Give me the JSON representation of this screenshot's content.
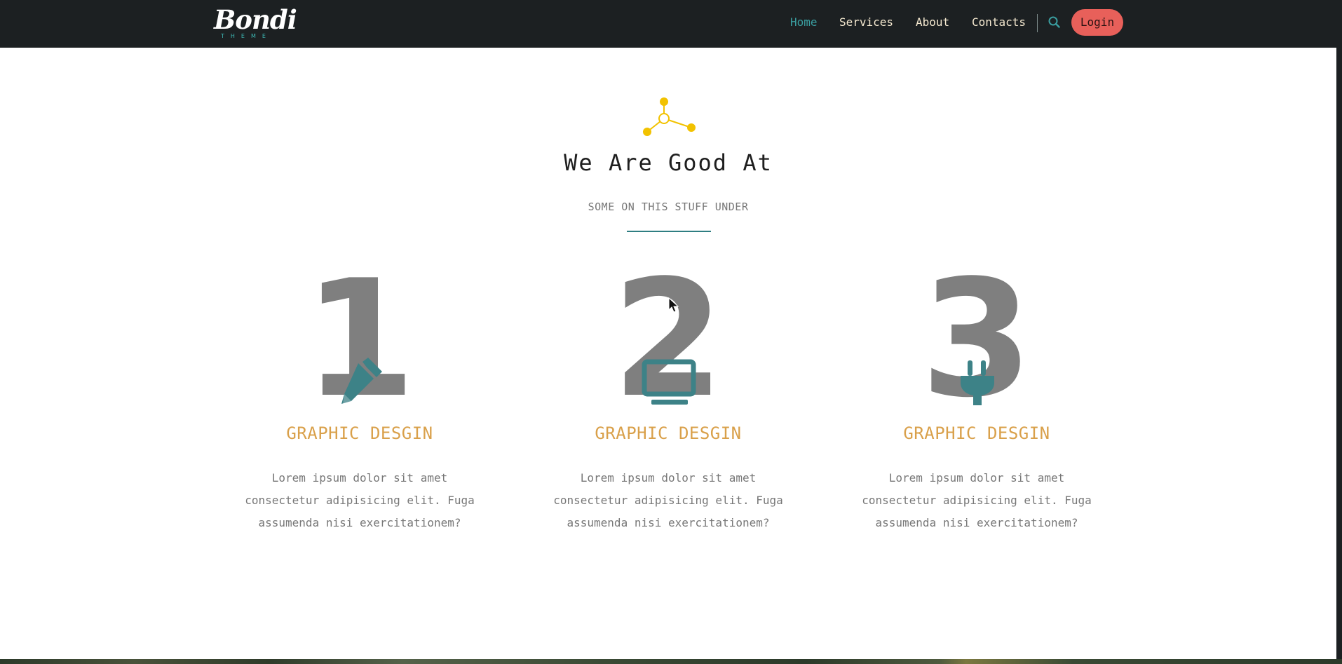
{
  "header": {
    "logo": {
      "script": "Bondi",
      "sub": "THEME"
    },
    "nav": [
      {
        "label": "Home",
        "active": true
      },
      {
        "label": "Services",
        "active": false
      },
      {
        "label": "About",
        "active": false
      },
      {
        "label": "Contacts",
        "active": false
      }
    ],
    "search_icon": "search-icon",
    "login_label": "Login"
  },
  "section": {
    "icon": "molecule-icon",
    "title": "We Are Good At",
    "subtitle": "SOME ON THIS STUFF UNDER"
  },
  "features": [
    {
      "number": "1",
      "icon": "pencil-icon",
      "title": "GRAPHIC DESGIN",
      "text": "Lorem ipsum dolor sit amet consectetur adipisicing elit. Fuga assumenda nisi exercitationem?"
    },
    {
      "number": "2",
      "icon": "laptop-icon",
      "title": "GRAPHIC DESGIN",
      "text": "Lorem ipsum dolor sit amet consectetur adipisicing elit. Fuga assumenda nisi exercitationem?"
    },
    {
      "number": "3",
      "icon": "plug-icon",
      "title": "GRAPHIC DESGIN",
      "text": "Lorem ipsum dolor sit amet consectetur adipisicing elit. Fuga assumenda nisi exercitationem?"
    }
  ],
  "colors": {
    "header_bg": "#1c2022",
    "nav_text": "#f5e9d0",
    "nav_active": "#3a9ea0",
    "login_bg": "#e8605a",
    "accent_teal": "#3d8287",
    "icon_yellow": "#f2c200",
    "feature_title": "#d9a04a",
    "digit_gray": "#7f7f7f"
  }
}
